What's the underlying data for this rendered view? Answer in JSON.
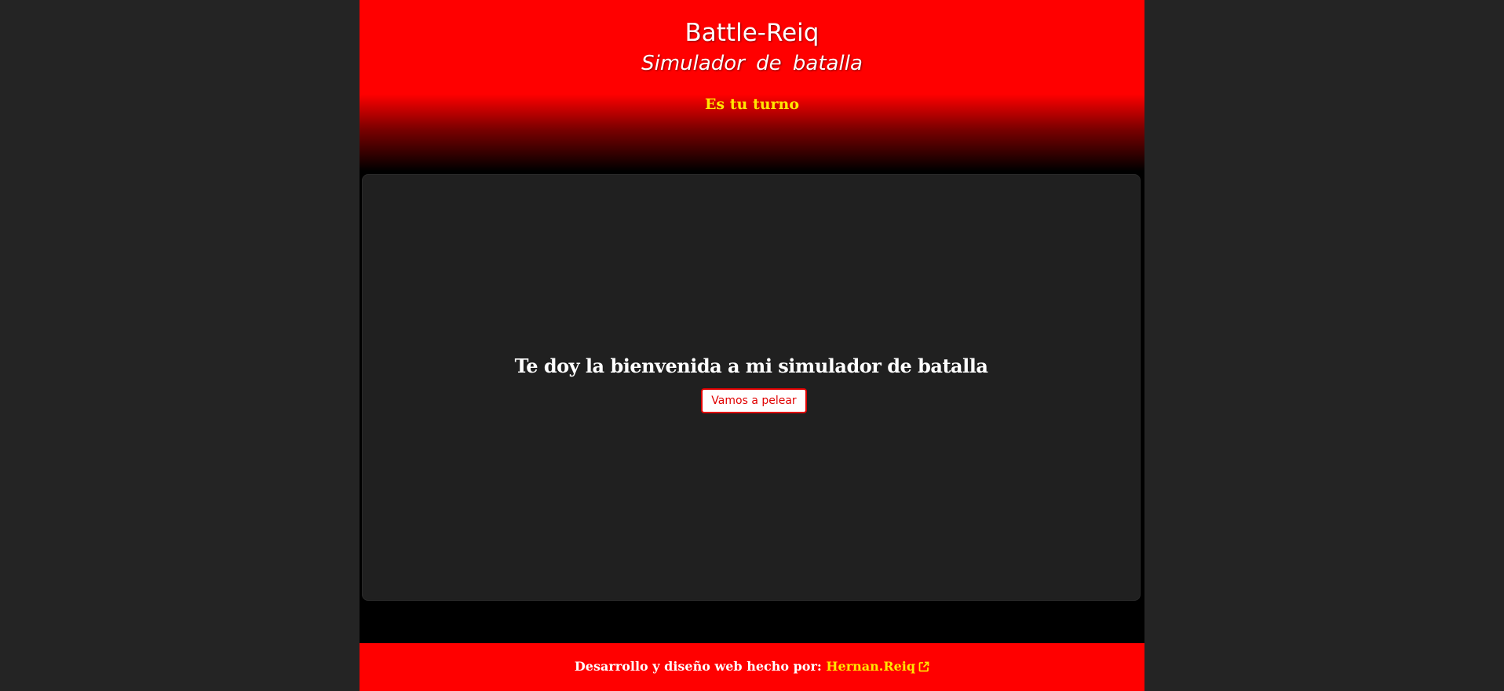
{
  "header": {
    "title": "Battle-Reiq",
    "subtitle": "Simulador de batalla",
    "turn_status": "Es tu turno"
  },
  "arena": {
    "welcome_text": "Te doy la bienvenida a mi simulador de batalla",
    "start_button_label": "Vamos a pelear"
  },
  "footer": {
    "credit_text": "Desarrollo y diseño web hecho por:",
    "author_link_label": "Hernan.Reiq",
    "author_link_icon": "external-link-icon"
  },
  "colors": {
    "page_background": "#242424",
    "brand_red": "#ff0000",
    "highlight_yellow": "#ffe600",
    "arena_background": "#202020"
  }
}
